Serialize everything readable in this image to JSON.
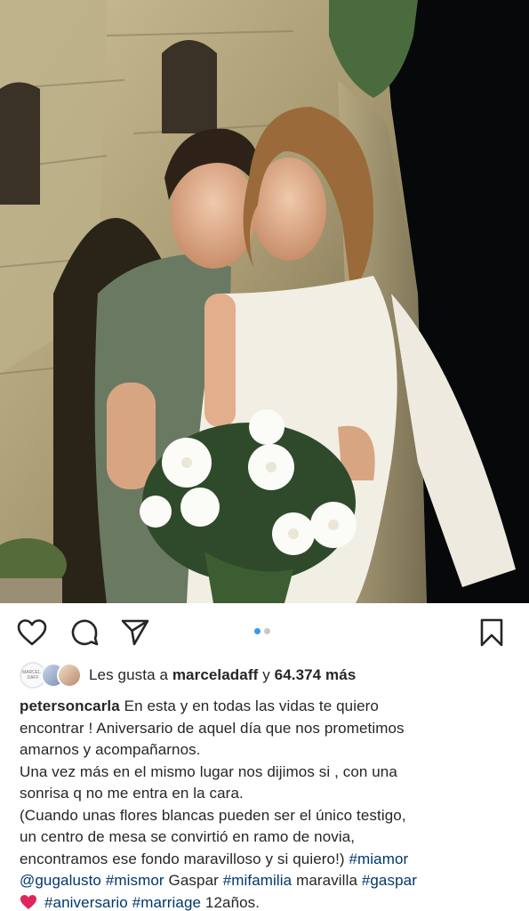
{
  "post": {
    "carousel": {
      "count": 2,
      "active_index": 0
    },
    "icons": {
      "like": "heart-outline-icon",
      "comment": "comment-bubble-icon",
      "share": "paper-plane-icon",
      "save": "bookmark-icon"
    },
    "likes": {
      "prefix": "Les gusta a",
      "first_user": "marceladaff",
      "connector": "y",
      "count_label": "64.374 más",
      "avatar_1_text": "MARCELA DAFF"
    },
    "caption": {
      "username": "petersoncarla",
      "l1_text": "En esta y en todas las vidas te quiero",
      "l2_text": "encontrar ! Aniversario de aquel día que nos prometimos",
      "l3_text": "amarnos y acompañarnos.",
      "l4_text": "Una vez más en el mismo lugar nos dijimos si , con una",
      "l5_text": "sonrisa q no me entra en la cara.",
      "l6_text": "(Cuando unas flores blancas pueden ser el único testigo,",
      "l7_text": "un centro de mesa se convirtió en ramo de novia,",
      "l8_text": "encontramos ese fondo maravilloso y si quiero!)",
      "tag_miamor": "#miamor",
      "mention_gugalusto": "@gugalusto",
      "tag_mismor": "#mismor",
      "word_gaspar": "Gaspar",
      "tag_mifamilia": "#mifamilia",
      "word_maravilla": "maravilla",
      "tag_gaspar": "#gaspar",
      "tag_aniversario": "#aniversario",
      "tag_marriage": "#marriage",
      "word_years": "12años."
    },
    "colors": {
      "text": "#262626",
      "link": "#00376b",
      "active_dot": "#3897f0",
      "inactive_dot": "#c7c7c7",
      "heart_emoji": "#e0245e"
    }
  }
}
